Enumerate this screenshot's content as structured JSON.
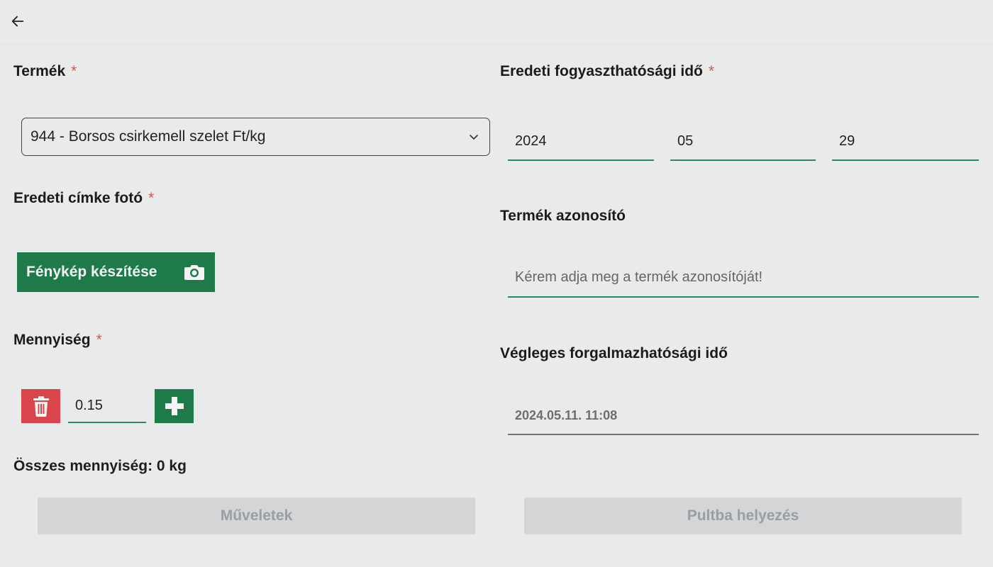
{
  "header": {
    "back_icon": "arrow-left-icon"
  },
  "left": {
    "product": {
      "label": "Termék",
      "required_mark": "*",
      "selected_value": "944 - Borsos csirkemell szelet Ft/kg",
      "dropdown_icon": "chevron-down-icon"
    },
    "photo": {
      "label": "Eredeti címke fotó",
      "required_mark": "*",
      "button_label": "Fénykép készítése",
      "button_icon": "camera-icon"
    },
    "quantity": {
      "label": "Mennyiség",
      "required_mark": "*",
      "value": "0.15",
      "delete_icon": "trash-icon",
      "add_icon": "plus-icon"
    },
    "total": "Összes mennyiség: 0 kg",
    "operations_button": "Műveletek"
  },
  "right": {
    "expiry": {
      "label": "Eredeti fogyaszthatósági idő",
      "required_mark": "*",
      "year": "2024",
      "month": "05",
      "day": "29"
    },
    "product_id": {
      "label": "Termék azonosító",
      "placeholder": "Kérem adja meg a termék azonosítóját!"
    },
    "final_date": {
      "label": "Végleges forgalmazhatósági idő",
      "value": "2024.05.11. 11:08"
    },
    "place_button": "Pultba helyezés"
  },
  "colors": {
    "accent_green": "#1f7a4a",
    "danger_red": "#d9454a",
    "required_red": "#d9534f",
    "disabled_button": "#d3d5d6"
  }
}
